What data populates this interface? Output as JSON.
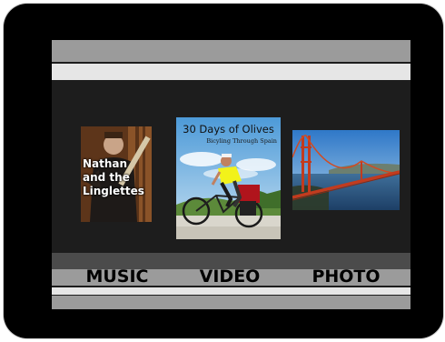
{
  "menu": {
    "items": [
      {
        "label": "MUSIC"
      },
      {
        "label": "VIDEO"
      },
      {
        "label": "PHOTO"
      }
    ]
  },
  "thumbnails": {
    "music": {
      "text_lines": [
        "Nathan",
        "and the",
        "Linglettes"
      ]
    },
    "video": {
      "title": "30 Days of Olives",
      "subtitle": "Bicyling Through Spain"
    },
    "photo": {
      "subject": "golden-gate-bridge"
    }
  },
  "colors": {
    "device_frame": "#000000",
    "screen_background": "#1d1d1d",
    "band_gray": "#9b9b9b",
    "band_light": "#e6e6e6",
    "band_dark": "#4b4b4b",
    "menu_text": "#000000"
  }
}
